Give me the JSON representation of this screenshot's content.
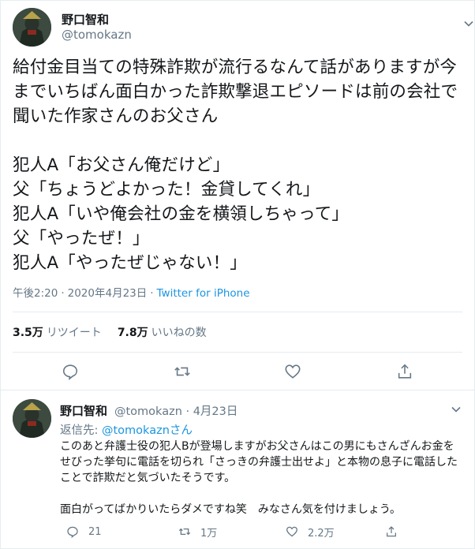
{
  "main_tweet": {
    "author_name": "野口智和",
    "author_handle": "@tomokazn",
    "text": "給付金目当ての特殊詐欺が流行るなんて話がありますが今までいちばん面白かった詐欺撃退エピソードは前の会社で聞いた作家さんのお父さん\n\n犯人A「お父さん俺だけど」\n父「ちょうどよかった！金貸してくれ」\n犯人A「いや俺会社の金を横領しちゃって」\n父「やったぜ！」\n犯人A「やったぜじゃない！」",
    "time": "午後2:20",
    "date": "2020年4月23日",
    "dot": "·",
    "source": "Twitter for iPhone",
    "retweets_count": "3.5万",
    "retweets_label": "リツイート",
    "likes_count": "7.8万",
    "likes_label": "いいねの数"
  },
  "reply_tweet": {
    "author_name": "野口智和",
    "author_handle": "@tomokazn · 4月23日",
    "reply_prefix": "返信先: ",
    "reply_mention": "@tomokaznさん",
    "text": "このあと弁護士役の犯人Bが登場しますがお父さんはこの男にもさんざんお金をせびった挙句に電話を切られ「さっきの弁護士出せよ」と本物の息子に電話したことで詐欺だと気づいたそうです。\n\n面白がってばかりいたらダメですね笑　みなさん気を付けましょう。",
    "replies": "21",
    "retweets": "1万",
    "likes": "2.2万"
  },
  "icons": {
    "reply": "reply-icon",
    "retweet": "retweet-icon",
    "like": "heart-icon",
    "share": "share-icon",
    "menu": "chevron-down-icon"
  },
  "colors": {
    "text": "#14171a",
    "secondary": "#657786",
    "link": "#1b95e0",
    "border": "#e6ecf0"
  }
}
